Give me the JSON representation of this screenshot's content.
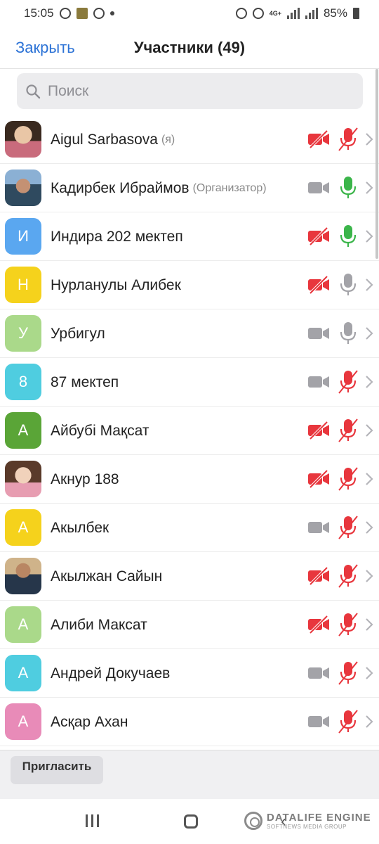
{
  "status_bar": {
    "time": "15:05",
    "network": "4G+",
    "battery": "85%"
  },
  "header": {
    "close_label": "Закрыть",
    "title": "Участники (49)"
  },
  "search": {
    "placeholder": "Поиск"
  },
  "colors": {
    "accent": "#2d73d6",
    "muted_red": "#e8363d",
    "mic_active": "#3bb54a",
    "icon_gray": "#a3a3a8"
  },
  "participants": [
    {
      "name": "Aigul Sarbasova",
      "tag": "(я)",
      "avatar_type": "photo",
      "avatar_letter": "",
      "avatar_color": "",
      "video": "off",
      "audio": "muted"
    },
    {
      "name": "Кадирбек Ибраймов",
      "tag": "(Организатор)",
      "avatar_type": "photo",
      "avatar_letter": "",
      "avatar_color": "",
      "video": "on",
      "audio": "active"
    },
    {
      "name": "Индира 202 мектеп",
      "tag": "",
      "avatar_type": "letter",
      "avatar_letter": "И",
      "avatar_color": "#5aa7f0",
      "video": "off",
      "audio": "active"
    },
    {
      "name": "Нурланулы Алибек",
      "tag": "",
      "avatar_type": "letter",
      "avatar_letter": "Н",
      "avatar_color": "#f5d21c",
      "video": "off",
      "audio": "on"
    },
    {
      "name": "Урбигул",
      "tag": "",
      "avatar_type": "letter",
      "avatar_letter": "У",
      "avatar_color": "#aad98a",
      "video": "on",
      "audio": "on"
    },
    {
      "name": "87 мектеп",
      "tag": "",
      "avatar_type": "letter",
      "avatar_letter": "8",
      "avatar_color": "#4fcde0",
      "video": "on",
      "audio": "muted"
    },
    {
      "name": "Айбубі Мақсат",
      "tag": "",
      "avatar_type": "letter",
      "avatar_letter": "А",
      "avatar_color": "#5aa537",
      "video": "off",
      "audio": "muted"
    },
    {
      "name": "Акнур 188",
      "tag": "",
      "avatar_type": "photo",
      "avatar_letter": "",
      "avatar_color": "",
      "video": "off",
      "audio": "muted"
    },
    {
      "name": "Акылбек",
      "tag": "",
      "avatar_type": "letter",
      "avatar_letter": "А",
      "avatar_color": "#f5d21c",
      "video": "on",
      "audio": "muted"
    },
    {
      "name": "Акылжан Сайын",
      "tag": "",
      "avatar_type": "photo",
      "avatar_letter": "",
      "avatar_color": "",
      "video": "off",
      "audio": "muted"
    },
    {
      "name": "Алиби Максат",
      "tag": "",
      "avatar_type": "letter",
      "avatar_letter": "А",
      "avatar_color": "#aad98a",
      "video": "off",
      "audio": "muted"
    },
    {
      "name": "Андрей Докучаев",
      "tag": "",
      "avatar_type": "letter",
      "avatar_letter": "А",
      "avatar_color": "#4fcde0",
      "video": "on",
      "audio": "muted"
    },
    {
      "name": "Асқар Ахан",
      "tag": "",
      "avatar_type": "letter",
      "avatar_letter": "А",
      "avatar_color": "#e88bb8",
      "video": "on",
      "audio": "muted"
    }
  ],
  "footer": {
    "invite_label": "Пригласить"
  },
  "watermark": {
    "line1": "DATALIFE ENGINE",
    "line2": "SOFTNEWS MEDIA GROUP"
  }
}
